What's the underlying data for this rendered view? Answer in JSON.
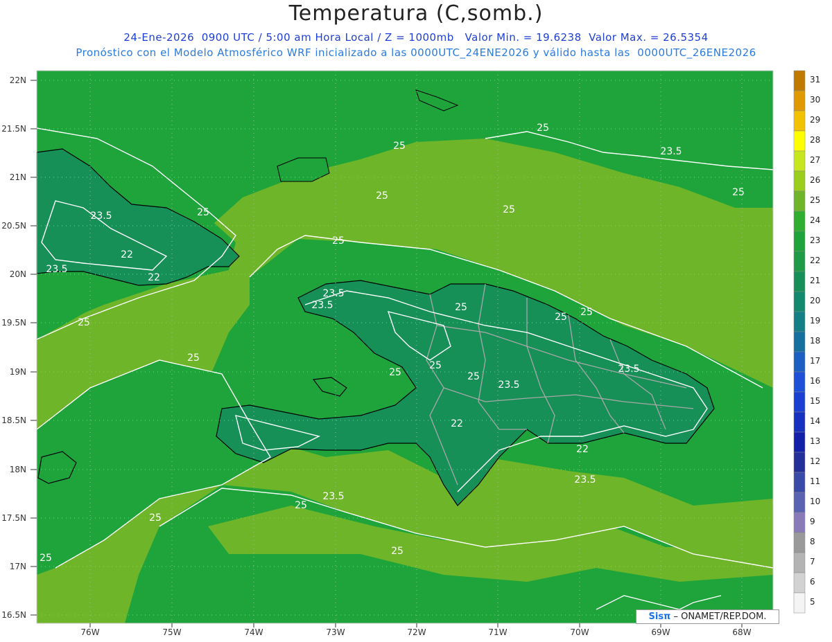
{
  "header": {
    "title": "Temperatura (C,somb.)",
    "line1": "24-Ene-2026  0900 UTC / 5:00 am Hora Local / Z = 1000mb   Valor Min. = 19.6238  Valor Max. = 26.5354",
    "line2": "Pronóstico con el Modelo Atmosférico WRF inicializado a las 0000UTC_24ENE2026 y válido hasta las  0000UTC_26ENE2026"
  },
  "axes": {
    "lat_labels": [
      "22N",
      "21.5N",
      "21N",
      "20.5N",
      "20N",
      "19.5N",
      "19N",
      "18.5N",
      "18N",
      "17.5N",
      "17N",
      "16.5N"
    ],
    "lon_labels": [
      "76W",
      "75W",
      "74W",
      "73W",
      "72W",
      "71W",
      "70W",
      "69W",
      "68W"
    ]
  },
  "contour_labels": [
    "25",
    "23.5",
    "22",
    "25",
    "23.5",
    "22",
    "23.5",
    "25",
    "23.5",
    "25",
    "25",
    "25",
    "25",
    "23.5",
    "25",
    "25",
    "25",
    "25",
    "25",
    "25",
    "25",
    "25",
    "23.5",
    "23.5",
    "22",
    "22",
    "23.5",
    "23.5",
    "25",
    "25",
    "25",
    "25"
  ],
  "colorbar": {
    "labels": [
      "31",
      "30",
      "29",
      "28",
      "27",
      "26",
      "25",
      "24",
      "23",
      "22",
      "21",
      "20",
      "19",
      "18",
      "17",
      "16",
      "15",
      "14",
      "13",
      "12",
      "11",
      "10",
      "9",
      "8",
      "7",
      "6",
      "5"
    ],
    "colors": [
      "#c07a00",
      "#e09a00",
      "#f2c200",
      "#ffff00",
      "#c8e61e",
      "#9acd1c",
      "#6fb52a",
      "#2fae2f",
      "#1ea43a",
      "#1f9a46",
      "#179058",
      "#138a6e",
      "#157f86",
      "#1570a0",
      "#1b5fc0",
      "#1e4fd8",
      "#1a3fd2",
      "#1630c0",
      "#1220aa",
      "#24309a",
      "#3a4aa8",
      "#5a62b2",
      "#8a7ab8",
      "#9a9a9a",
      "#b4b4b4",
      "#d2d2d2",
      "#f4f4f4"
    ]
  },
  "colors": {
    "sea_warm": "#6fb52a",
    "land_mid": "#1ea43a",
    "land_cool": "#179058",
    "contour": "#ffffff",
    "coast": "#000000",
    "border": "#a8a8a8"
  },
  "credit": {
    "brand": "Sisπ",
    "text": " – ONAMET/REP.DOM."
  }
}
